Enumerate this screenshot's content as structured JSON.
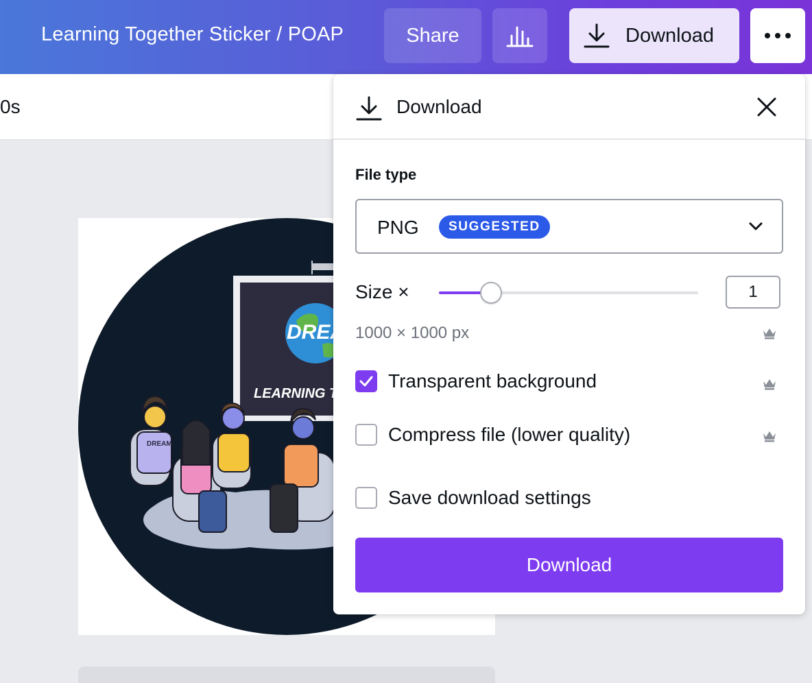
{
  "header": {
    "doc_title": "Learning Together Sticker / POAP",
    "share_label": "Share",
    "insights_icon": "bar-chart-icon",
    "download_label": "Download",
    "more_icon": "more-horizontal-icon"
  },
  "toolbar": {
    "duration": "0s"
  },
  "canvas": {
    "artwork_text_1": "DREAM",
    "artwork_text_2": "LEARNING TOGETHER",
    "artwork_shirt_text": "DREAM"
  },
  "download_panel": {
    "title": "Download",
    "close_icon": "close-icon",
    "file_type_label": "File type",
    "file_type_value": "PNG",
    "file_type_badge": "SUGGESTED",
    "size_label": "Size ×",
    "size_value": "1",
    "size_slider_fraction": 0.2,
    "dimensions": "1000 × 1000 px",
    "options": [
      {
        "label": "Transparent background",
        "checked": true,
        "premium": true
      },
      {
        "label": "Compress file (lower quality)",
        "checked": false,
        "premium": true
      },
      {
        "label": "Save download settings",
        "checked": false,
        "premium": false
      }
    ],
    "download_button": "Download"
  },
  "colors": {
    "accent": "#7d3cf0",
    "badge": "#2b59e8",
    "header_gradient_start": "#4a77d9",
    "header_gradient_end": "#7a33d8"
  }
}
